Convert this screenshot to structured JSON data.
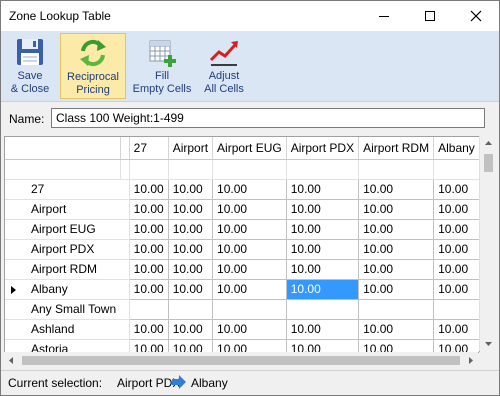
{
  "window": {
    "title": "Zone Lookup Table"
  },
  "toolbar": {
    "save": {
      "label": "Save\n& Close",
      "icon": "save-disk-icon"
    },
    "reciprocal": {
      "label": "Reciprocal\nPricing",
      "icon": "reciprocal-arrows-icon",
      "active": true
    },
    "fill": {
      "label": "Fill\nEmpty Cells",
      "icon": "fill-grid-icon"
    },
    "adjust": {
      "label": "Adjust\nAll Cells",
      "icon": "adjust-trend-icon"
    }
  },
  "name_field": {
    "label": "Name:",
    "value": "Class 100 Weight:1-499"
  },
  "grid": {
    "columns": [
      "27",
      "Airport",
      "Airport EUG",
      "Airport PDX",
      "Airport RDM",
      "Albany"
    ],
    "rows": [
      {
        "name": "27",
        "values": [
          "10.00",
          "10.00",
          "10.00",
          "10.00",
          "10.00",
          "10.00"
        ]
      },
      {
        "name": "Airport",
        "values": [
          "10.00",
          "10.00",
          "10.00",
          "10.00",
          "10.00",
          "10.00"
        ]
      },
      {
        "name": "Airport EUG",
        "values": [
          "10.00",
          "10.00",
          "10.00",
          "10.00",
          "10.00",
          "10.00"
        ]
      },
      {
        "name": "Airport PDX",
        "values": [
          "10.00",
          "10.00",
          "10.00",
          "10.00",
          "10.00",
          "10.00"
        ]
      },
      {
        "name": "Airport RDM",
        "values": [
          "10.00",
          "10.00",
          "10.00",
          "10.00",
          "10.00",
          "10.00"
        ]
      },
      {
        "name": "Albany",
        "values": [
          "10.00",
          "10.00",
          "10.00",
          "10.00",
          "10.00",
          "10.00"
        ],
        "current": true
      },
      {
        "name": "Any Small Town",
        "values": [
          "",
          "",
          "",
          "",
          "",
          ""
        ]
      },
      {
        "name": "Ashland",
        "values": [
          "10.00",
          "10.00",
          "10.00",
          "10.00",
          "10.00",
          "10.00"
        ]
      },
      {
        "name": "Astoria",
        "values": [
          "10.00",
          "10.00",
          "10.00",
          "10.00",
          "10.00",
          "10.00"
        ]
      }
    ],
    "selected": {
      "row": 5,
      "col": 3
    }
  },
  "status": {
    "label": "Current selection:",
    "from": "Airport PDX",
    "to": "Albany"
  },
  "colors": {
    "selection": "#3399ff",
    "toolbar": "#dbe6f4",
    "active_button": "#fbeaa8",
    "label_text": "#1f3d7a"
  }
}
